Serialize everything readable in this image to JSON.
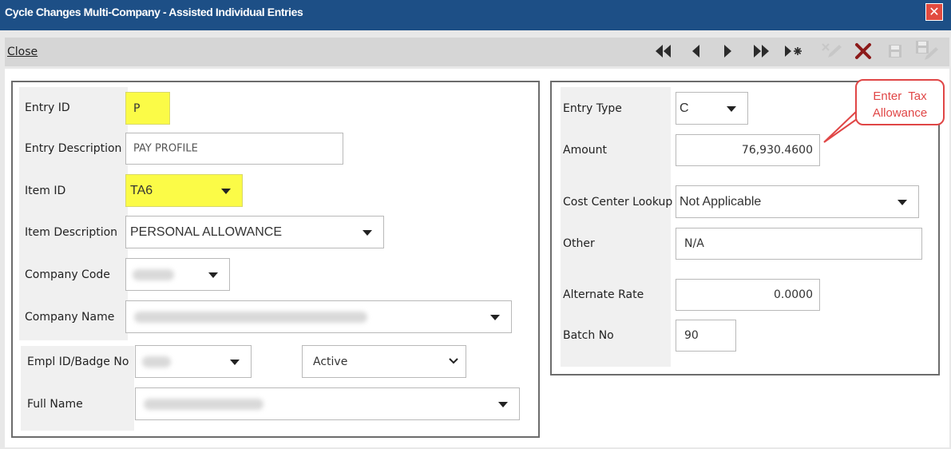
{
  "window": {
    "title": "Cycle Changes Multi-Company - Assisted Individual Entries",
    "close_glyph": "✕"
  },
  "toolbar": {
    "close_label": "Close",
    "buttons": [
      "first-record-icon",
      "previous-record-icon",
      "next-record-icon",
      "last-record-icon",
      "new-record-icon",
      "edit-icon",
      "delete-icon",
      "save-icon",
      "save-edit-icon"
    ]
  },
  "left": {
    "entry_id": {
      "label": "Entry ID",
      "value": "P"
    },
    "entry_description": {
      "label": "Entry Description",
      "value": "PAY PROFILE"
    },
    "item_id": {
      "label": "Item ID",
      "value": "TA6"
    },
    "item_description": {
      "label": "Item Description",
      "value": "PERSONAL ALLOWANCE"
    },
    "company_code": {
      "label": "Company Code"
    },
    "company_name": {
      "label": "Company Name"
    },
    "empl_id": {
      "label": "Empl ID/Badge No"
    },
    "status": {
      "value": "Active"
    },
    "full_name": {
      "label": "Full Name"
    }
  },
  "right": {
    "entry_type": {
      "label": "Entry Type",
      "value": "C"
    },
    "amount": {
      "label": "Amount",
      "value": "76,930.4600"
    },
    "cost_center": {
      "label": "Cost Center Lookup",
      "value": "Not Applicable"
    },
    "other": {
      "label": "Other",
      "value": "N/A"
    },
    "alternate_rate": {
      "label": "Alternate Rate",
      "value": "0.0000"
    },
    "batch_no": {
      "label": "Batch No",
      "value": "90"
    }
  },
  "callout": {
    "line1": "Enter  Tax",
    "line2": "Allowance",
    "color": "#e04646"
  },
  "colors": {
    "titlebar": "#1d4f86",
    "highlight": "#fbfb47",
    "close_button": "#e24b40"
  }
}
